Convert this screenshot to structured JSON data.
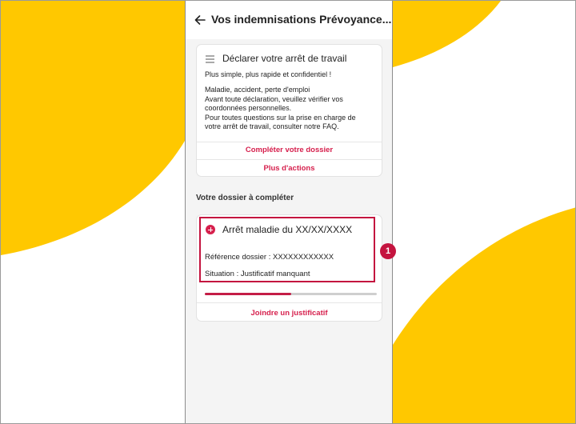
{
  "appbar": {
    "title": "Vos indemnisations Prévoyance..."
  },
  "declare_card": {
    "title": "Déclarer votre arrêt de travail",
    "subtitle": "Plus simple, plus rapide et confidentiel !",
    "body_lines": [
      "Maladie, accident, perte d'emploi",
      "Avant toute déclaration, veuillez vérifier vos",
      "coordonnées personnelles.",
      "Pour toutes questions sur la prise en charge de",
      "votre arrêt de travail, consulter notre FAQ."
    ],
    "complete_action": "Compléter votre dossier",
    "more_actions": "Plus d'actions"
  },
  "section": {
    "title": "Votre dossier à compléter"
  },
  "dossier_card": {
    "title": "Arrêt maladie du XX/XX/XXXX",
    "reference": "Référence dossier : XXXXXXXXXXXX",
    "situation": "Situation : Justificatif manquant",
    "progress": 0.5,
    "attach_action": "Joindre un justificatif"
  },
  "annotation": {
    "step_number": "1"
  },
  "colors": {
    "accent": "#d6204d",
    "highlight": "#c4143f",
    "decoration_yellow": "#ffc800",
    "screen_background": "#f4f4f4"
  },
  "icons": {
    "back": "arrow-left-icon",
    "menu": "menu-lines-icon",
    "add": "plus-circle-icon"
  }
}
